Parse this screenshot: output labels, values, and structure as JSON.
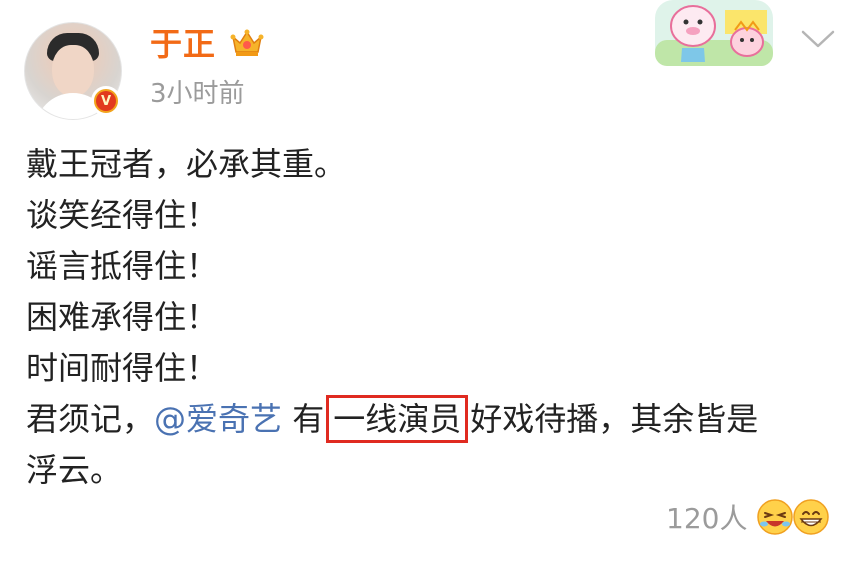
{
  "author": {
    "name": "于正",
    "time": "3小时前",
    "badge_glyph": "V"
  },
  "post": {
    "lines": [
      "戴王冠者，必承其重。",
      "谈笑经得住！",
      "谣言抵得住！",
      "困难承得住！",
      "时间耐得住！"
    ],
    "last_line": {
      "prefix": "君须记，",
      "mention": "@爱奇艺",
      "middle": " 有",
      "highlighted": "一线演员",
      "suffix": "好戏待播，其余皆是"
    },
    "wrap_line": "浮云。"
  },
  "footer": {
    "like_count": "120人"
  },
  "colors": {
    "name": "#f26a16",
    "mention": "#4a72b2",
    "highlight_border": "#e02a20",
    "muted": "#9b9b9b"
  },
  "icons": [
    "crown-icon",
    "verified-badge-icon",
    "card-decoration-image",
    "chevron-down-icon",
    "laughing-emoji-icon",
    "grinning-emoji-icon"
  ]
}
